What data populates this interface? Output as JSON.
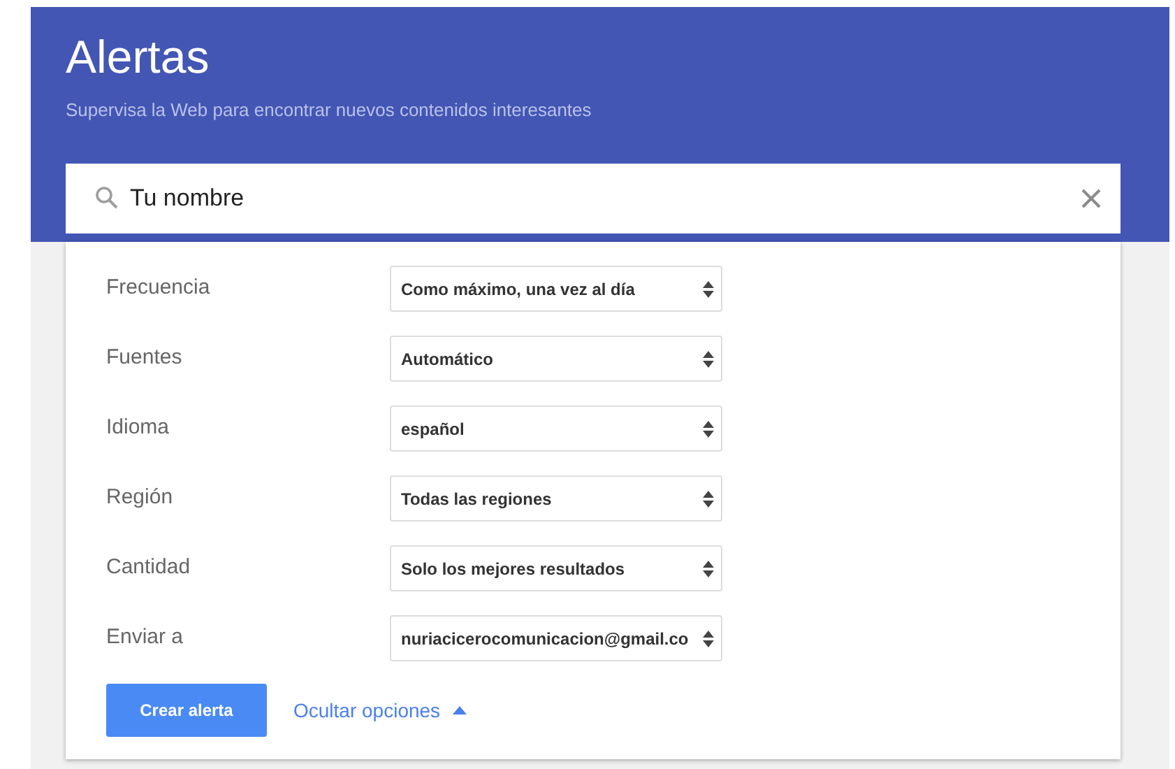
{
  "header": {
    "title": "Alertas",
    "subtitle": "Supervisa la Web para encontrar nuevos contenidos interesantes"
  },
  "search": {
    "value": "Tu nombre"
  },
  "options": [
    {
      "label": "Frecuencia",
      "value": "Como máximo, una vez al día"
    },
    {
      "label": "Fuentes",
      "value": "Automático"
    },
    {
      "label": "Idioma",
      "value": "español"
    },
    {
      "label": "Región",
      "value": "Todas las regiones"
    },
    {
      "label": "Cantidad",
      "value": "Solo los mejores resultados"
    },
    {
      "label": "Enviar a",
      "value": "nuriacicerocomunicacion@gmail.co"
    }
  ],
  "create_button": "Crear alerta",
  "options_toggle": {
    "label": "Ocultar opciones",
    "expanded": true
  }
}
